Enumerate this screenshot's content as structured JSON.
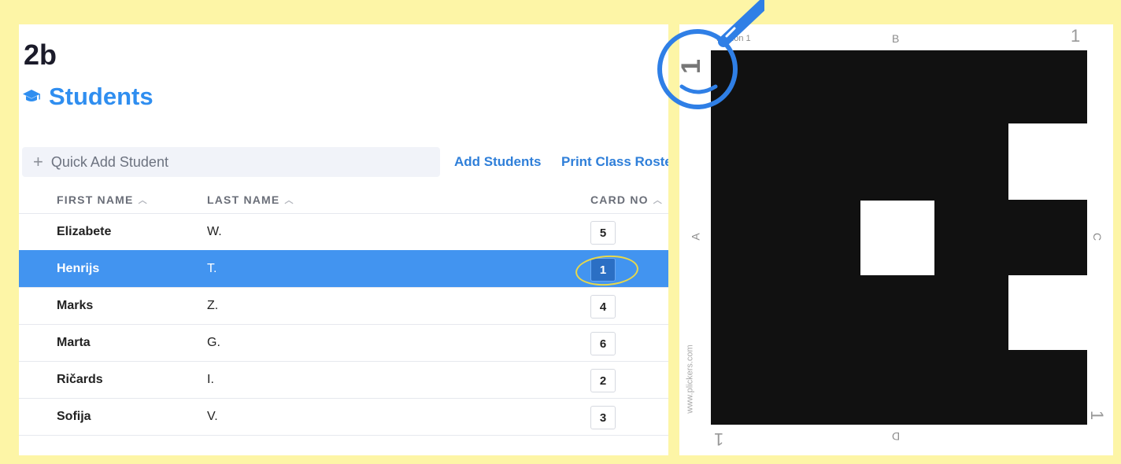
{
  "class_title": "2b",
  "section": {
    "icon": "graduation-cap-icon",
    "title": "Students"
  },
  "toolbar": {
    "quick_add_placeholder": "Quick Add Student",
    "add_students": "Add Students",
    "print_roster": "Print Class Roste"
  },
  "table": {
    "headers": {
      "first_name": "FIRST NAME",
      "last_name": "LAST NAME",
      "card_no": "CARD NO"
    },
    "rows": [
      {
        "first": "Elizabete",
        "last": "W.",
        "card": "5",
        "selected": false
      },
      {
        "first": "Henrijs",
        "last": "T.",
        "card": "1",
        "selected": true
      },
      {
        "first": "Marks",
        "last": "Z.",
        "card": "4",
        "selected": false
      },
      {
        "first": "Marta",
        "last": "G.",
        "card": "6",
        "selected": false
      },
      {
        "first": "Ričards",
        "last": "I.",
        "card": "2",
        "selected": false
      },
      {
        "first": "Sofija",
        "last": "V.",
        "card": "3",
        "selected": false
      }
    ]
  },
  "plicker_card": {
    "version": "version 1",
    "side_top": "B",
    "side_left": "A",
    "side_right": "C",
    "side_bottom": "D",
    "number": "1",
    "website": "www.plickers.com"
  },
  "colors": {
    "accent": "#2f8ef0",
    "selected_row": "#4294f0",
    "frame": "#fdf5a6",
    "magnifier": "#2f7fe6"
  }
}
